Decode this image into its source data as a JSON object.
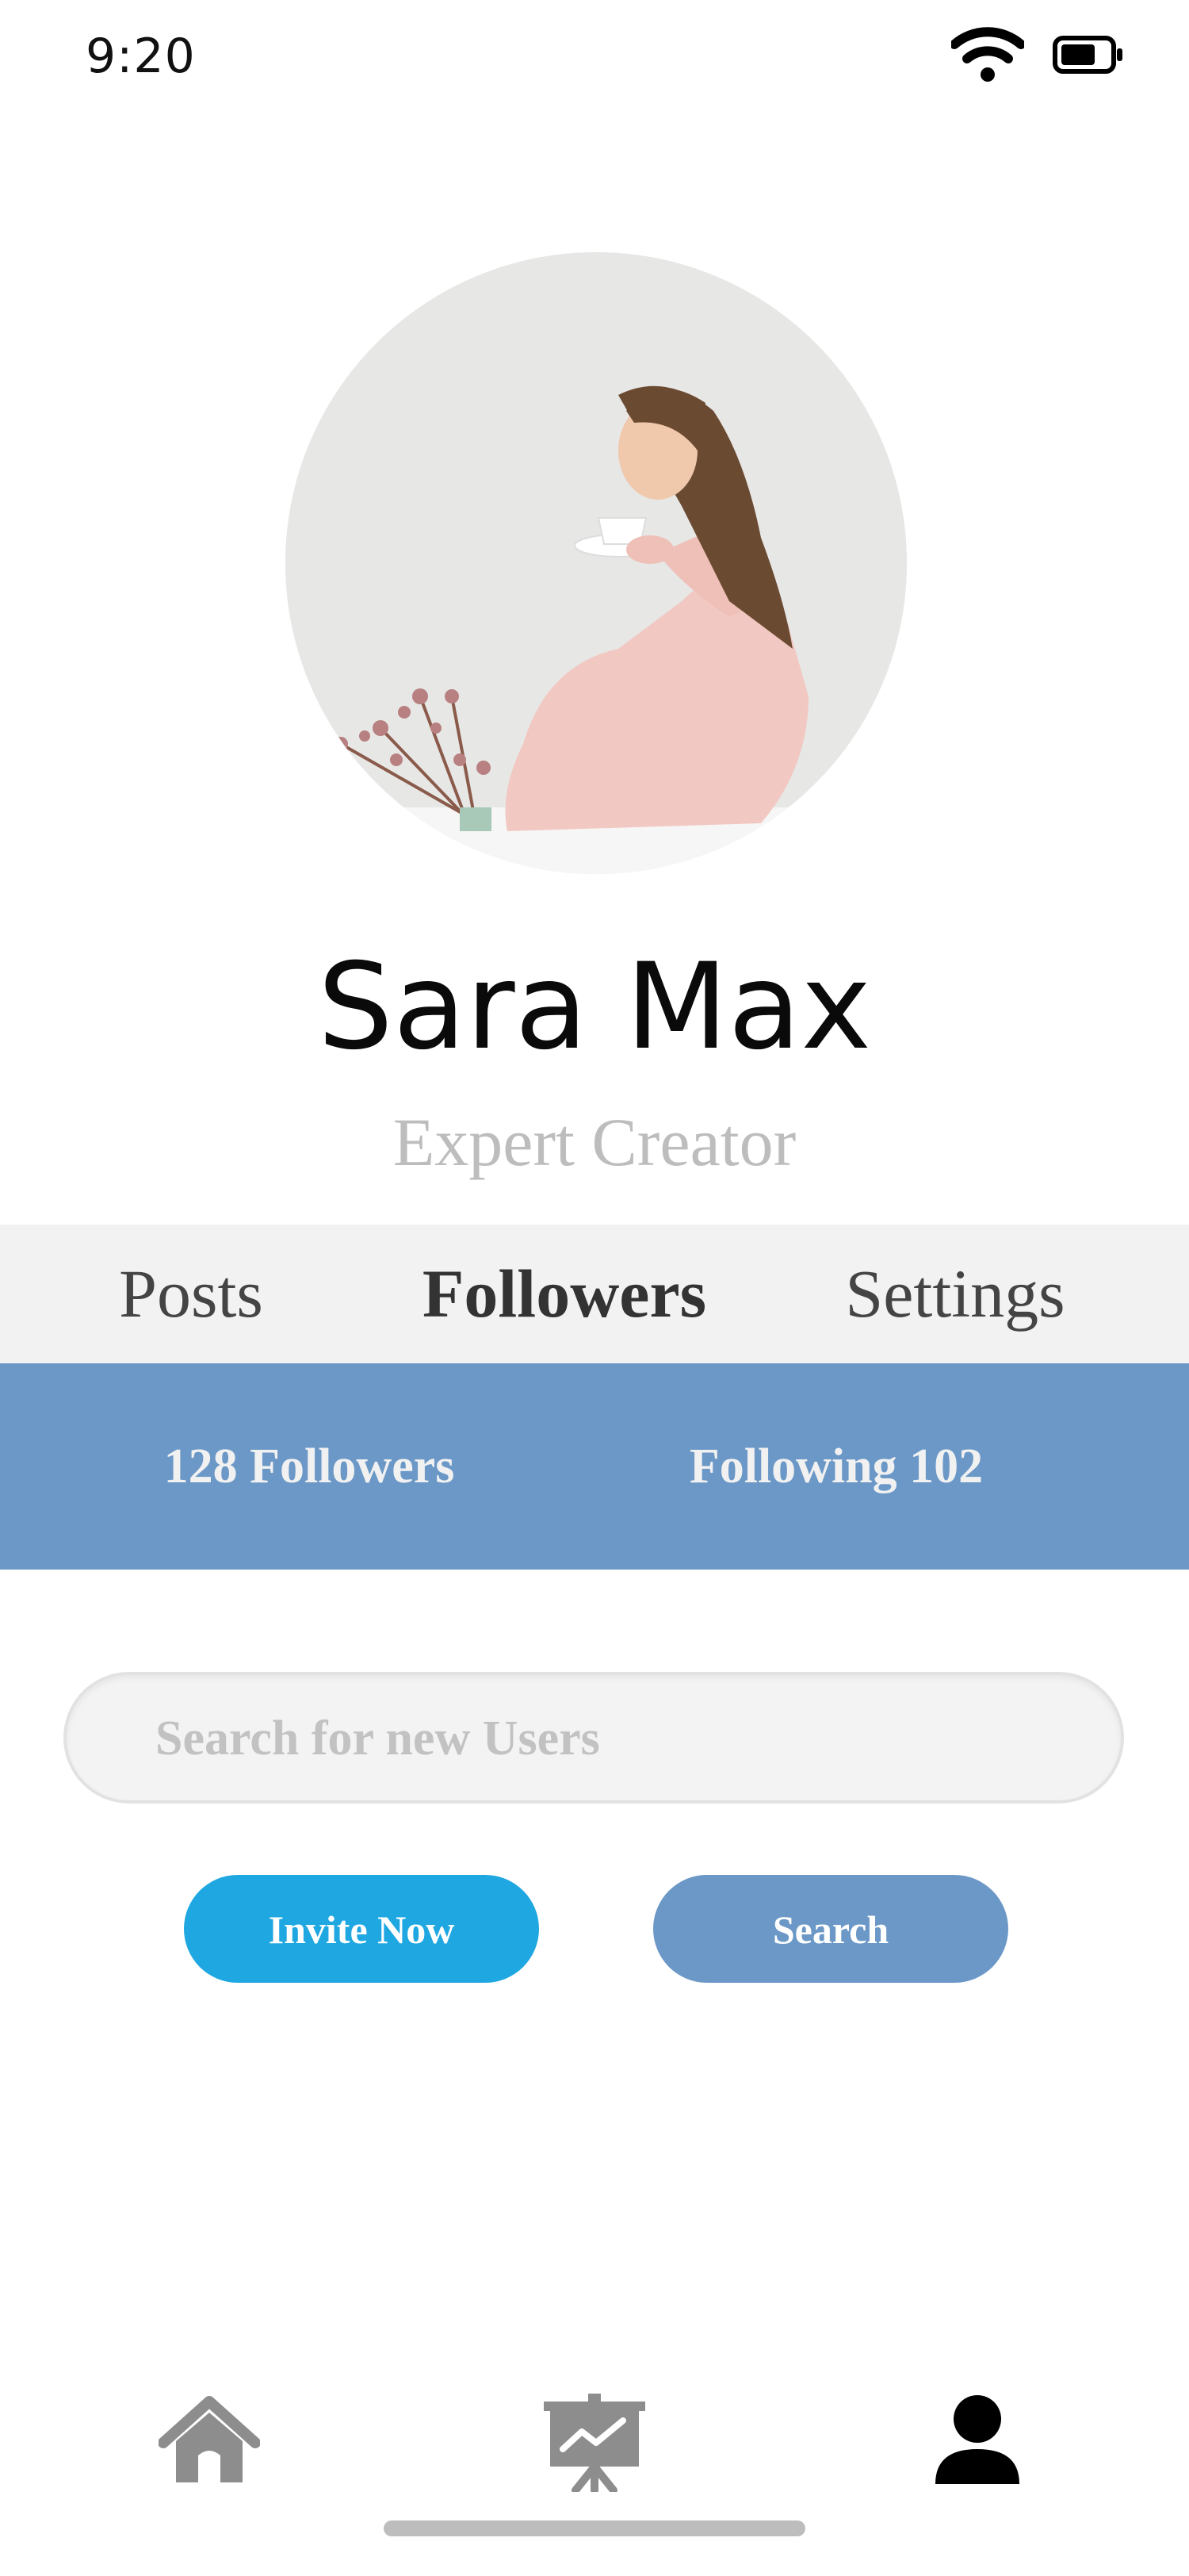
{
  "status_bar": {
    "time": "9:20",
    "icons": [
      "wifi-icon",
      "battery-icon"
    ]
  },
  "profile": {
    "name": "Sara Max",
    "role": "Expert Creator",
    "avatar_description": "profile photo"
  },
  "tabs": [
    {
      "label": "Posts",
      "active": false
    },
    {
      "label": "Followers",
      "active": true
    },
    {
      "label": "Settings",
      "active": false
    }
  ],
  "follow_stats": {
    "followers": "128 Followers",
    "following": "Following 102"
  },
  "search": {
    "placeholder": "Search for new Users",
    "value": ""
  },
  "actions": {
    "invite_label": "Invite Now",
    "search_label": "Search"
  },
  "bottom_nav": [
    {
      "icon": "home-icon",
      "active": false
    },
    {
      "icon": "presentation-chart-icon",
      "active": false
    },
    {
      "icon": "user-icon",
      "active": true
    }
  ],
  "colors": {
    "banner": "#6b98c7",
    "invite_button": "#1ea7e1",
    "search_button": "#6b98c7",
    "tab_bar": "#f2f2f2"
  }
}
